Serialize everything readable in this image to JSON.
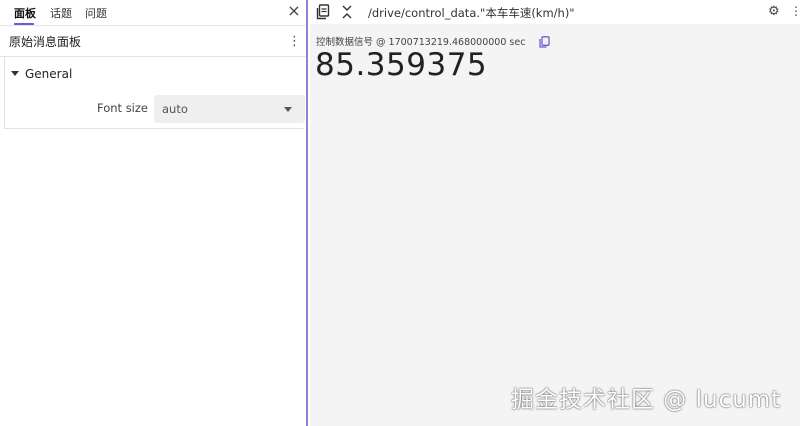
{
  "sidebar": {
    "tabs": [
      {
        "label": "面板",
        "active": true
      },
      {
        "label": "话题",
        "active": false
      },
      {
        "label": "问题",
        "active": false
      }
    ],
    "close_icon": "×",
    "panel": {
      "title": "原始消息面板",
      "menu_icon": "⋮"
    },
    "section": {
      "label": "General"
    },
    "font_size": {
      "label": "Font size",
      "value": "auto"
    }
  },
  "main": {
    "topic": "/drive/control_data.\"本车车速(km/h)\"",
    "meta": "控制数据信号 @ 1700713219.468000000 sec",
    "value": "85.359375",
    "accent_color": "#6f5bd1"
  },
  "watermark": "掘金技术社区 @ lucumt"
}
